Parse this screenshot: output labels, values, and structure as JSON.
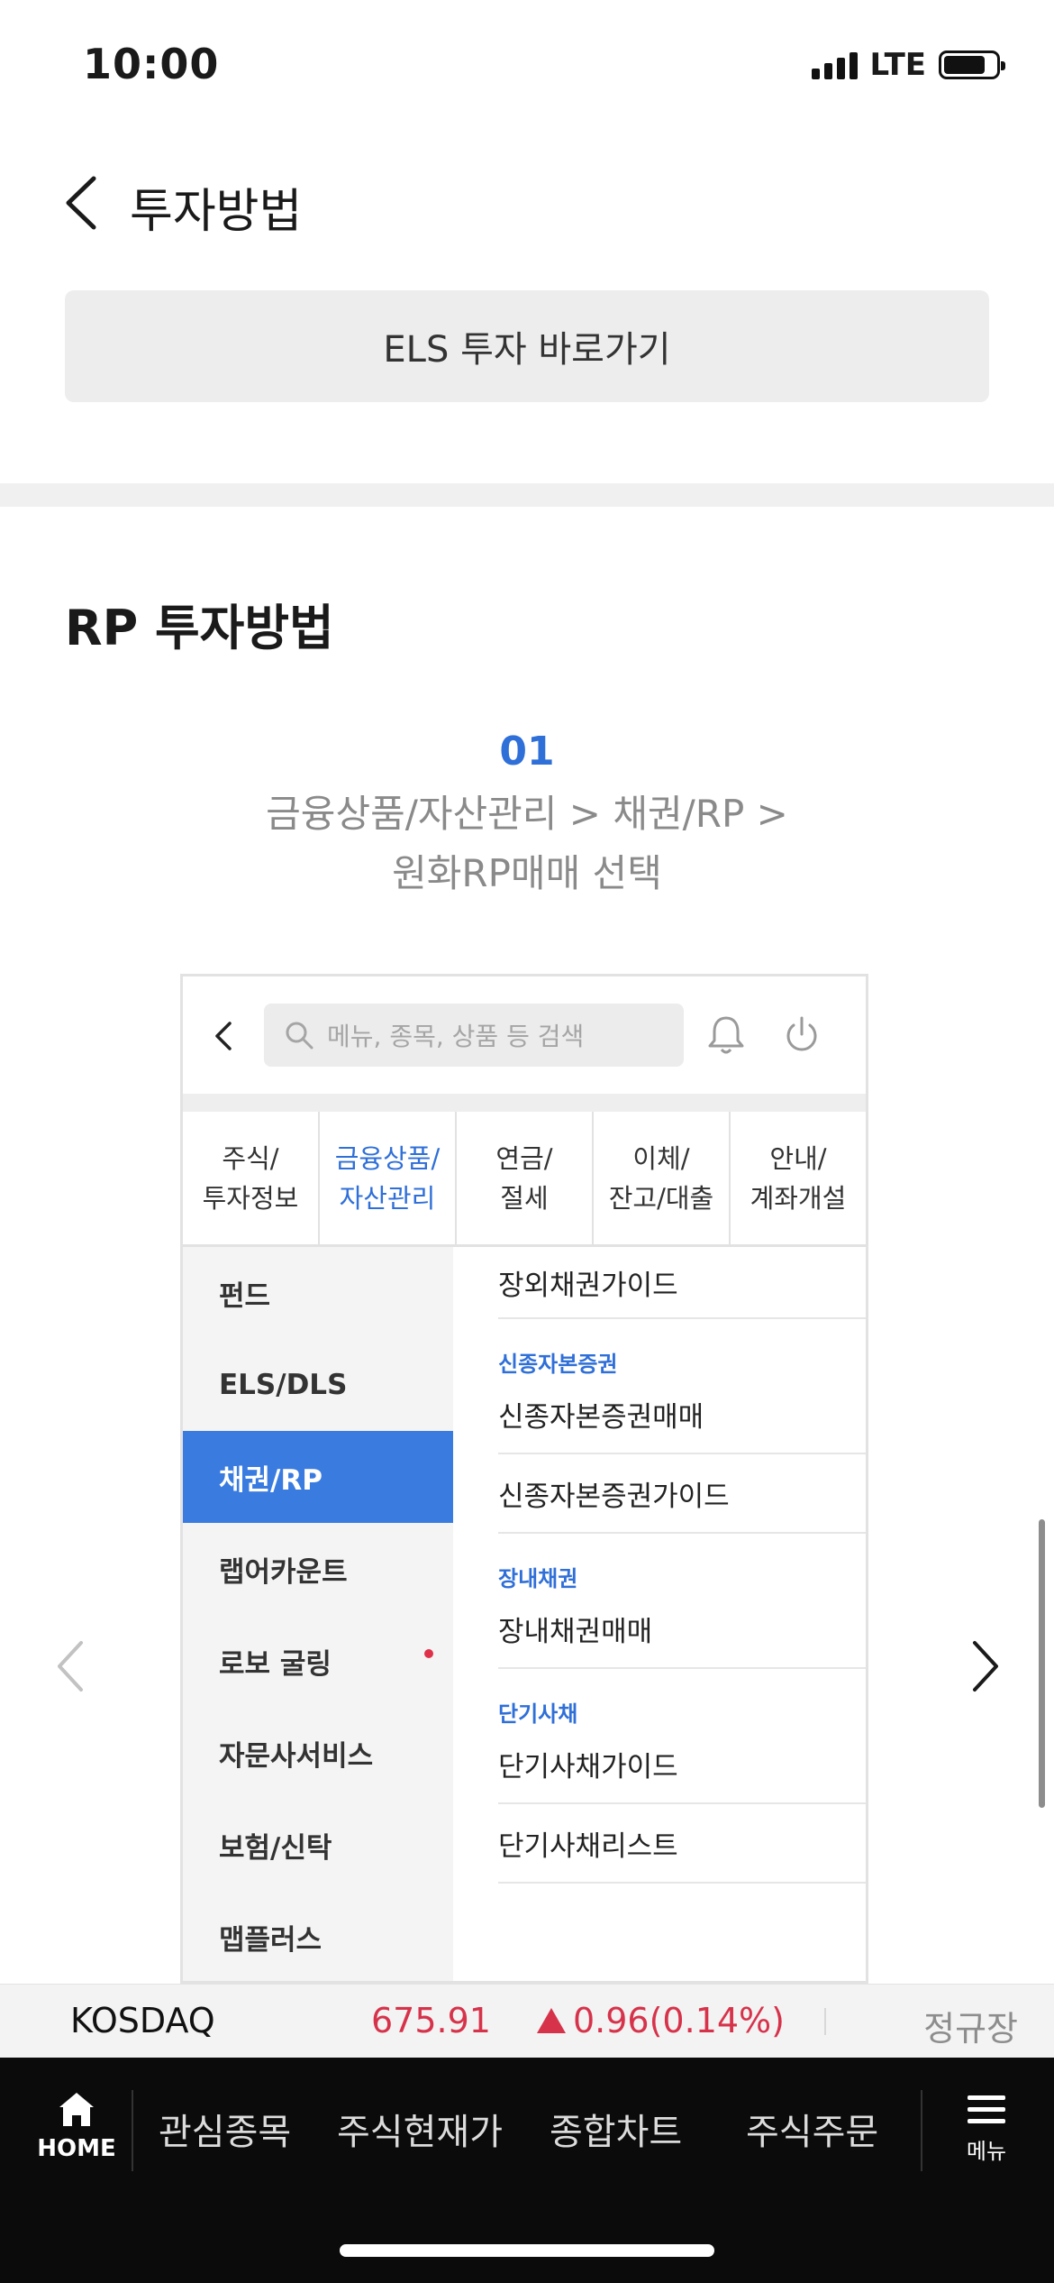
{
  "status_bar": {
    "time": "10:00",
    "network": "LTE"
  },
  "header": {
    "title": "투자방법"
  },
  "els_button": {
    "label": "ELS 투자 바로가기"
  },
  "section": {
    "title": "RP 투자방법"
  },
  "step": {
    "number": "01",
    "desc_line1": "금융상품/자산관리 > 채권/RP >",
    "desc_line2": "원화RP매매 선택"
  },
  "mockup": {
    "search_placeholder": "메뉴, 종목, 상품 등 검색",
    "tabs": [
      {
        "label": "주식/\n투자정보"
      },
      {
        "label": "금융상품/\n자산관리"
      },
      {
        "label": "연금/\n절세"
      },
      {
        "label": "이체/\n잔고/대출"
      },
      {
        "label": "안내/\n계좌개설"
      }
    ],
    "left_items": [
      {
        "label": "펀드"
      },
      {
        "label": "ELS/DLS"
      },
      {
        "label": "채권/RP"
      },
      {
        "label": "랩어카운트"
      },
      {
        "label": "로보 굴링"
      },
      {
        "label": "자문사서비스"
      },
      {
        "label": "보험/신탁"
      },
      {
        "label": "맵플러스"
      }
    ],
    "right": {
      "item0": "장외채권가이드",
      "cat1": "신종자본증권",
      "item1a": "신종자본증권매매",
      "item1b": "신종자본증권가이드",
      "cat2": "장내채권",
      "item2a": "장내채권매매",
      "cat3": "단기사채",
      "item3a": "단기사채가이드",
      "item3b": "단기사채리스트"
    }
  },
  "ticker": {
    "name": "KOSDAQ",
    "value": "675.91",
    "change": "0.96(0.14%)",
    "status": "정규장",
    "up_color": "#d6334b"
  },
  "bottom_nav": {
    "home_label": "HOME",
    "items": [
      {
        "label": "관심종목"
      },
      {
        "label": "주식현재가"
      },
      {
        "label": "종합차트"
      },
      {
        "label": "주식주문"
      }
    ],
    "menu_label": "메뉴"
  },
  "colors": {
    "accent": "#2f6fd8",
    "active_menu_bg": "#3a7be0"
  }
}
